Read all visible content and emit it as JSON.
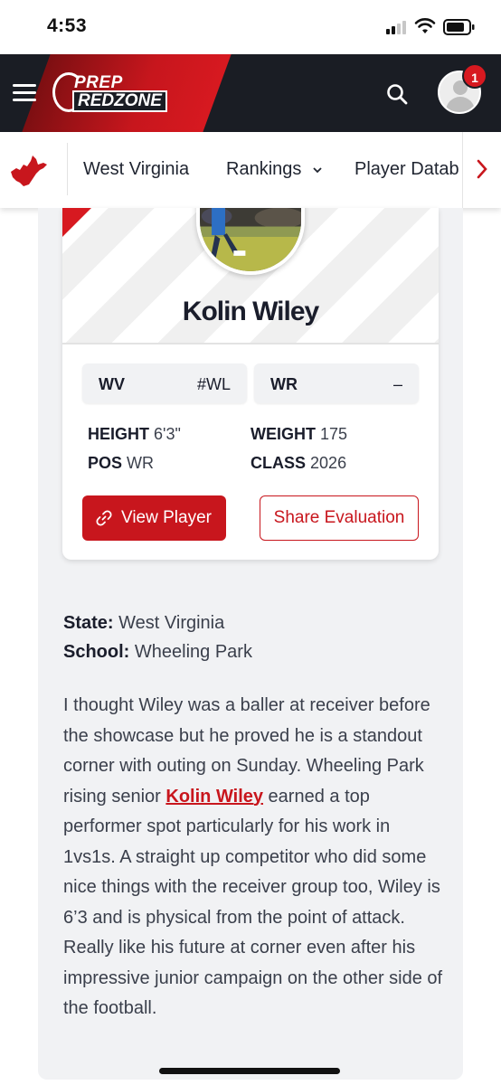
{
  "status_bar": {
    "time": "4:53"
  },
  "header": {
    "logo_top": "PREP",
    "logo_bottom": "REDZONE",
    "notification_count": "1"
  },
  "subnav": {
    "items": [
      {
        "label": "West Virginia"
      },
      {
        "label": "Rankings"
      },
      {
        "label": "Player Datab"
      }
    ]
  },
  "player": {
    "name": "Kolin Wiley",
    "state_abbr": "WV",
    "state_rank": "#WL",
    "position_abbr": "WR",
    "position_rank": "–",
    "height_label": "HEIGHT",
    "height": "6'3\"",
    "weight_label": "WEIGHT",
    "weight": "175",
    "pos_label": "POS",
    "pos": "WR",
    "class_label": "CLASS",
    "class": "2026",
    "view_button": "View Player",
    "share_button": "Share Evaluation"
  },
  "details": {
    "state_label": "State:",
    "state": "West Virginia",
    "school_label": "School:",
    "school": "Wheeling Park"
  },
  "article": {
    "before_link": "I thought Wiley was a baller at receiver before the showcase but he proved he is a standout corner with outing on Sunday. Wheeling Park rising senior ",
    "link": "Kolin Wiley",
    "after_link": " earned a top performer spot particularly for his work in 1vs1s. A straight up competitor who did some nice things with the receiver group too, Wiley is 6’3 and is physical from the point of attack. Really like his future at corner even after his impressive junior campaign on the other side of the football."
  },
  "colors": {
    "brand_red": "#c8161d",
    "header_dark": "#1a1d24",
    "content_bg": "#f1f2f4"
  },
  "icons": [
    "signal-icon",
    "wifi-icon",
    "battery-icon",
    "menu-icon",
    "search-icon",
    "avatar-icon",
    "state-map-icon",
    "chevron-down-icon",
    "chevron-right-icon",
    "link-icon"
  ]
}
